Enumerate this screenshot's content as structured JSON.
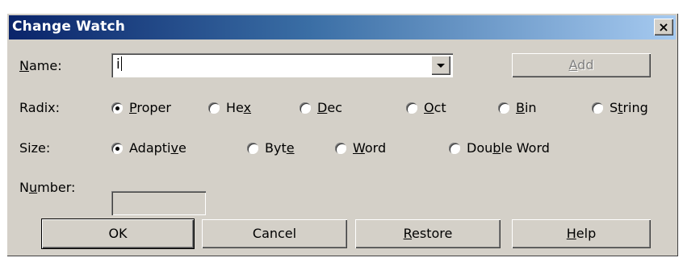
{
  "dialog": {
    "title": "Change Watch",
    "close_symbol": "×"
  },
  "name": {
    "label_mnemonic": "N",
    "label_rest": "ame:",
    "value": "i",
    "add_button": {
      "mnemonic": "A",
      "rest": "dd"
    }
  },
  "radix": {
    "label": "Radix:",
    "options": [
      {
        "pre": "",
        "mnemonic": "P",
        "post": "roper",
        "checked": true
      },
      {
        "pre": "He",
        "mnemonic": "x",
        "post": "",
        "checked": false
      },
      {
        "pre": "",
        "mnemonic": "D",
        "post": "ec",
        "checked": false
      },
      {
        "pre": "",
        "mnemonic": "O",
        "post": "ct",
        "checked": false
      },
      {
        "pre": "",
        "mnemonic": "B",
        "post": "in",
        "checked": false
      },
      {
        "pre": "S",
        "mnemonic": "t",
        "post": "ring",
        "checked": false
      }
    ]
  },
  "size": {
    "label": "Size:",
    "options": [
      {
        "pre": "Adapti",
        "mnemonic": "v",
        "post": "e",
        "checked": true
      },
      {
        "pre": "Byt",
        "mnemonic": "e",
        "post": "",
        "checked": false
      },
      {
        "pre": "",
        "mnemonic": "W",
        "post": "ord",
        "checked": false
      },
      {
        "pre": "Dou",
        "mnemonic": "b",
        "post": "le Word",
        "checked": false
      }
    ]
  },
  "number": {
    "label_pre": "N",
    "label_mnemonic": "u",
    "label_post": "mber:",
    "value": ""
  },
  "buttons": {
    "ok": "OK",
    "cancel": "Cancel",
    "restore": {
      "mnemonic": "R",
      "rest": "estore"
    },
    "help": {
      "mnemonic": "H",
      "rest": "elp"
    }
  }
}
